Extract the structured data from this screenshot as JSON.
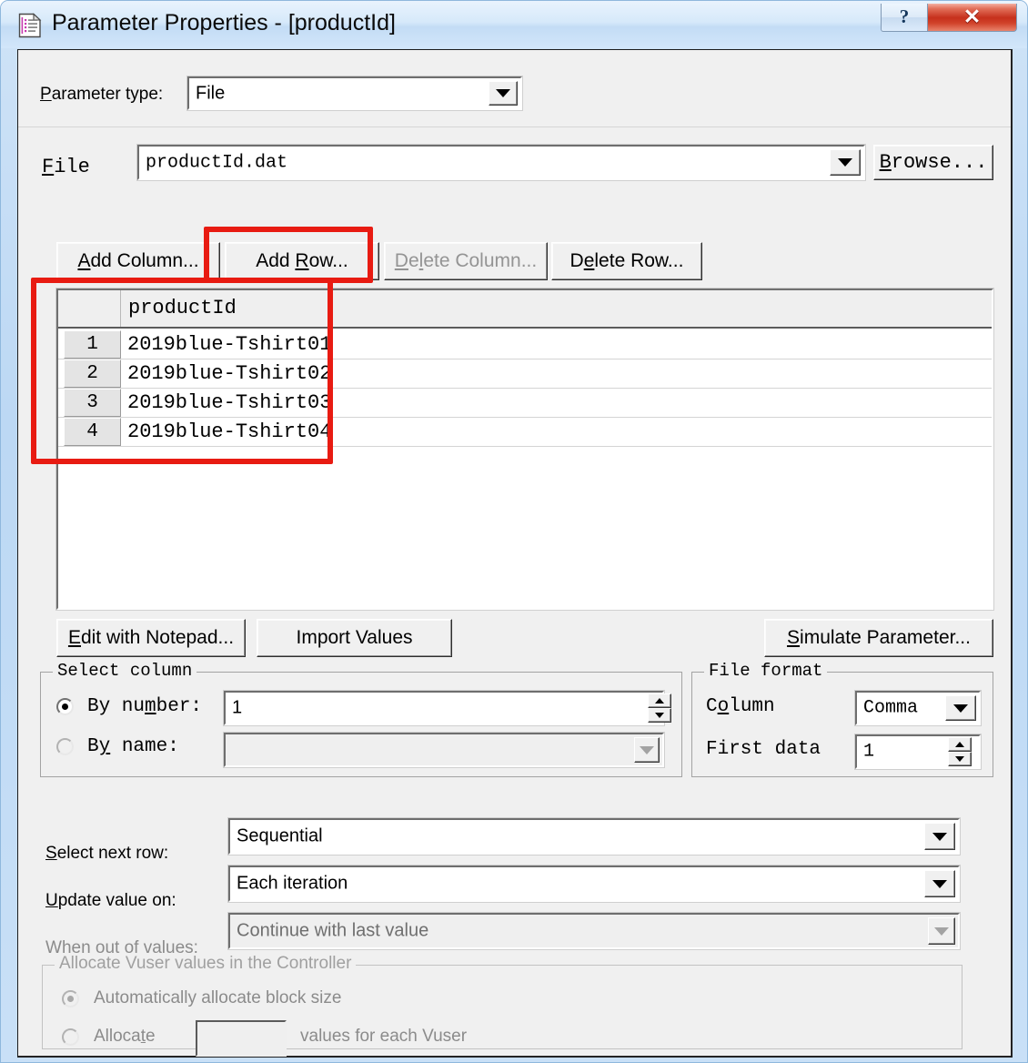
{
  "window": {
    "title": "Parameter Properties - [productId]",
    "icon": "parameter-document-icon",
    "help_label": "?",
    "close_label": "✕"
  },
  "parameter_type": {
    "label": "Parameter type:",
    "value": "File"
  },
  "file_row": {
    "label": "File",
    "value": "productId.dat",
    "browse_label": "Browse..."
  },
  "toolbar": {
    "add_column": "Add Column...",
    "add_row": "Add Row...",
    "delete_column": "Delete Column...",
    "delete_row": "Delete Row..."
  },
  "grid": {
    "columns": [
      "productId"
    ],
    "rows": [
      {
        "number": "1",
        "productId": "2019blue-Tshirt01"
      },
      {
        "number": "2",
        "productId": "2019blue-Tshirt02"
      },
      {
        "number": "3",
        "productId": "2019blue-Tshirt03"
      },
      {
        "number": "4",
        "productId": "2019blue-Tshirt04"
      }
    ]
  },
  "grid_buttons": {
    "edit_with_notepad": "Edit with Notepad...",
    "import_values": "Import Values",
    "simulate_parameter": "Simulate Parameter..."
  },
  "select_column": {
    "title": "Select column",
    "by_number_label": "By number:",
    "by_number_value": "1",
    "by_number_selected": true,
    "by_name_label": "By name:",
    "by_name_value": "",
    "by_name_selected": false
  },
  "file_format": {
    "title": "File format",
    "column_label": "Column",
    "column_value": "Comma",
    "first_data_label": "First data",
    "first_data_value": "1"
  },
  "options": {
    "select_next_row_label": "Select next row:",
    "select_next_row_value": "Sequential",
    "update_value_on_label": "Update value on:",
    "update_value_on_value": "Each iteration",
    "when_out_of_values_label": "When out of values:",
    "when_out_of_values_value": "Continue with last value"
  },
  "allocate": {
    "title": "Allocate Vuser values in the Controller",
    "auto_label": "Automatically allocate block size",
    "auto_selected": true,
    "allocate_label": "Allocate",
    "allocate_value": "",
    "allocate_suffix": "values for each Vuser",
    "allocate_selected": false
  },
  "annotations": {
    "accent_color": "#e81b12",
    "highlight_add_row": "Add Row...",
    "highlight_grid": "productId value list"
  }
}
